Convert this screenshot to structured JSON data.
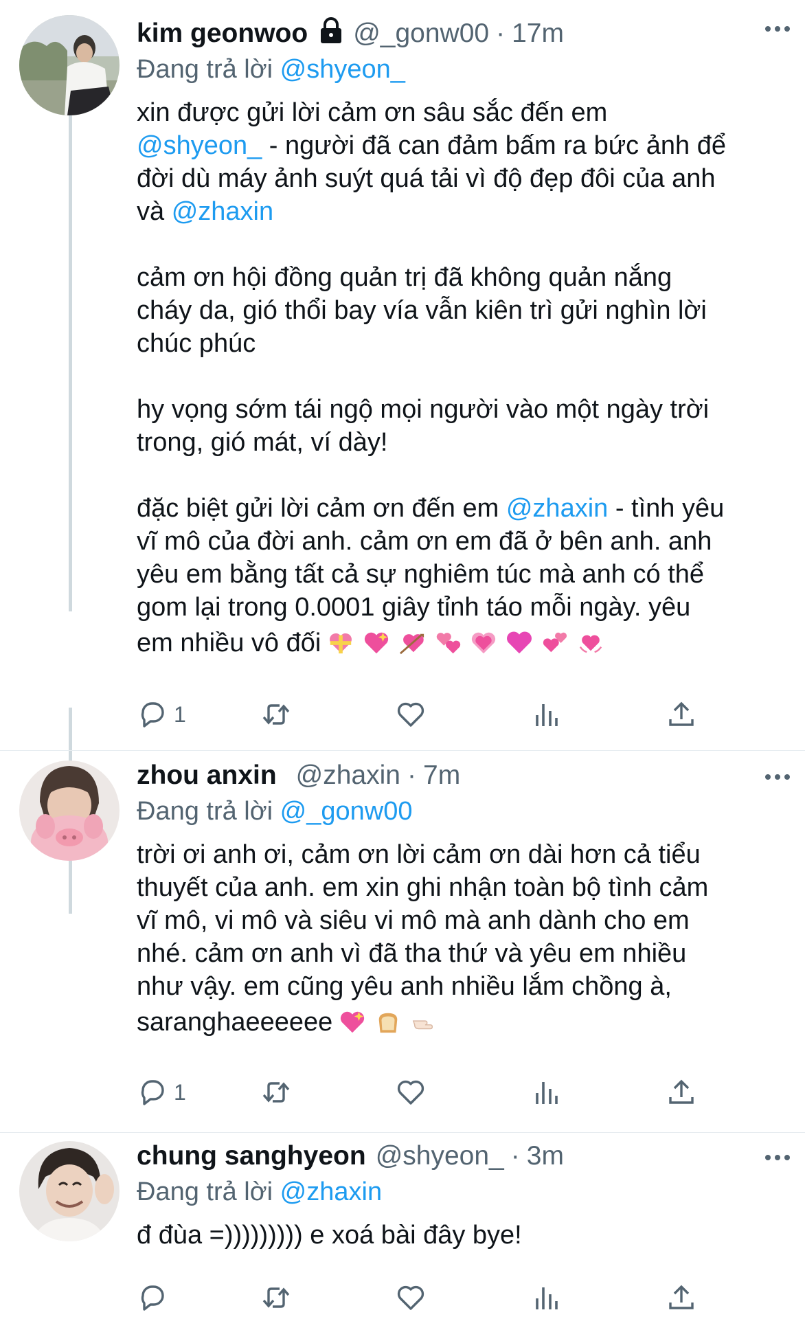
{
  "tweets": [
    {
      "display_name": "kim geonwoo",
      "handle": "@_gonw00",
      "time": "17m",
      "protected": true,
      "reply_prefix": "Đang trả lời",
      "reply_to": "@shyeon_",
      "paragraphs": [
        {
          "lines": [
            [
              "xin được gửi lời cảm ơn sâu sắc đến em"
            ],
            [
              {
                "mention": "@shyeon_"
              },
              " - người đã can đảm bấm ra bức ảnh để"
            ],
            [
              "đời dù máy ảnh suýt quá tải vì độ đẹp đôi của anh"
            ],
            [
              "và ",
              {
                "mention": "@zhaxin"
              }
            ]
          ]
        },
        {
          "lines": [
            [
              "cảm ơn hội đồng quản trị đã không quản nắng"
            ],
            [
              "cháy da, gió thổi bay vía vẫn kiên trì gửi nghìn lời"
            ],
            [
              "chúc phúc"
            ]
          ]
        },
        {
          "lines": [
            [
              "hy vọng sớm tái ngộ mọi người vào một ngày trời"
            ],
            [
              "trong, gió mát, ví dày!"
            ]
          ]
        },
        {
          "lines": [
            [
              "đặc biệt gửi lời cảm ơn đến em ",
              {
                "mention": "@zhaxin"
              },
              " - tình yêu"
            ],
            [
              "vĩ mô của đời anh. cảm ơn em đã ở bên anh. anh"
            ],
            [
              "yêu em bằng tất cả sự nghiêm túc mà anh có thể"
            ],
            [
              "gom lại trong 0.0001 giây tỉnh táo mỗi ngày. yêu"
            ],
            [
              "em nhiều vô đối",
              {
                "emojis": [
                  "heart-ribbon",
                  "sparkling-heart",
                  "heart-arrow",
                  "revolving-hearts",
                  "beating-heart",
                  "pink-heart",
                  "two-hearts",
                  "heart-waves"
                ]
              }
            ]
          ]
        }
      ],
      "actions": {
        "reply_count": "1",
        "retweet_count": "",
        "like_count": ""
      }
    },
    {
      "display_name": "zhou anxin",
      "handle": "@zhaxin",
      "time": "7m",
      "protected": false,
      "reply_prefix": "Đang trả lời",
      "reply_to": "@_gonw00",
      "paragraphs": [
        {
          "lines": [
            [
              "trời ơi anh ơi, cảm ơn lời cảm ơn dài hơn cả tiểu"
            ],
            [
              "thuyết của anh. em xin ghi nhận toàn bộ tình cảm"
            ],
            [
              "vĩ mô, vi mô và siêu vi mô mà anh dành cho em"
            ],
            [
              "nhé. cảm ơn anh vì đã tha thứ và yêu em nhiều"
            ],
            [
              "như vậy. em cũng yêu anh nhiều lắm chồng à,"
            ],
            [
              "saranghaeeeeee",
              {
                "emojis": [
                  "sparkling-heart",
                  "bread",
                  "hand-pointing"
                ]
              }
            ]
          ]
        }
      ],
      "actions": {
        "reply_count": "1",
        "retweet_count": "",
        "like_count": ""
      }
    },
    {
      "display_name": "chung sanghyeon",
      "handle": "@shyeon_",
      "time": "3m",
      "protected": false,
      "reply_prefix": "Đang trả lời",
      "reply_to": "@zhaxin",
      "paragraphs": [
        {
          "lines": [
            [
              "đ đùa =))))))))) e xoá bài đây bye!"
            ]
          ]
        }
      ],
      "actions": {
        "reply_count": "",
        "retweet_count": "",
        "like_count": ""
      }
    }
  ],
  "icons": {
    "more": "more-dots-icon",
    "reply": "reply-bubble-icon",
    "retweet": "retweet-icon",
    "like": "heart-outline-icon",
    "analytics": "analytics-bars-icon",
    "share": "share-upload-icon",
    "lock": "lock-icon"
  },
  "colors": {
    "mention": "#1d9bf0",
    "secondary": "#536471",
    "thread_line": "#cfd9de"
  }
}
